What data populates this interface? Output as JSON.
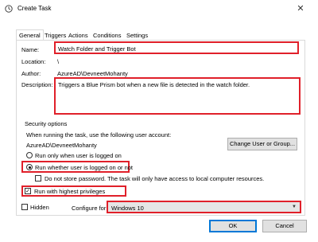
{
  "window": {
    "title": "Create Task"
  },
  "tabs": [
    "General",
    "Triggers",
    "Actions",
    "Conditions",
    "Settings"
  ],
  "general": {
    "name_label": "Name:",
    "name_value": "Watch Folder and Trigger Bot",
    "location_label": "Location:",
    "location_value": "\\",
    "author_label": "Author:",
    "author_value": "AzureAD\\DevneetMohanty",
    "description_label": "Description:",
    "description_value": "Triggers a Blue Prism bot when a new file is detected in the watch folder."
  },
  "security": {
    "group_label": "Security options",
    "account_prompt": "When running the task, use the following user account:",
    "account_value": "AzureAD\\DevneetMohanty",
    "change_button": "Change User or Group...",
    "radio_logged_on": "Run only when user is logged on",
    "radio_whether": "Run whether user is logged on or not",
    "store_password": "Do not store password.  The task will only have access to local computer resources.",
    "highest_privileges": "Run with highest privileges"
  },
  "bottom": {
    "hidden_label": "Hidden",
    "configure_label": "Configure for:",
    "configure_value": "Windows 10"
  },
  "buttons": {
    "ok": "OK",
    "cancel": "Cancel"
  },
  "state": {
    "selected_radio": "whether",
    "store_password_checked": false,
    "highest_privileges_checked": true,
    "hidden_checked": false
  },
  "colors": {
    "highlight": "#e0202a",
    "ok_border": "#0078d7"
  }
}
